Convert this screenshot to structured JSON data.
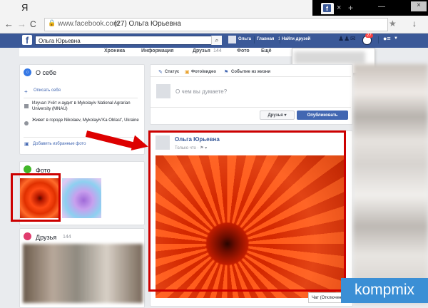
{
  "browser": {
    "tab_ya": "Я",
    "tab_fb_letter": "f",
    "tab_close": "×",
    "tab_new": "+",
    "window_min": "—",
    "window_close": "×",
    "url_domain": "www.facebook.com",
    "url_title": "(27) Ольга Юрьевна",
    "back": "←",
    "forward": "→",
    "reload": "C",
    "lock": "🔒",
    "bookmark": "★",
    "download": "↓"
  },
  "fb_bar": {
    "logo": "f",
    "search_value": "Ольга Юрьевна",
    "search_btn": "⌕",
    "user_name": "Ольга",
    "home": "Главная",
    "home_badge": "1",
    "find_friends": "Найти друзей",
    "notif_count": "27",
    "caret": "▼"
  },
  "profile_nav": [
    "Хроника",
    "Информация",
    "Друзья",
    "144",
    "Фото",
    "Ещё"
  ],
  "about": {
    "title": "О себе",
    "describe": "Описать себя",
    "study": "Изучал Учёт и аудит в Mykolayiv National Agrarian University (MNAU)",
    "live": "Живет в городе Nikolaev, Mykolayiv'Ka Oblast', Ukraine",
    "favorites": "Добавить избранные фото"
  },
  "photos": {
    "title": "Фото"
  },
  "friends": {
    "title": "Друзья",
    "count": "144"
  },
  "composer": {
    "status": "Статус",
    "photo_video": "Фото/видео",
    "life_event": "Событие из жизни",
    "placeholder": "О чем вы думаете?",
    "audience": "Друзья ▾",
    "publish": "Опубликовать"
  },
  "post": {
    "author": "Ольга Юрьевна",
    "time": "Только что · ⚑ ▾"
  },
  "chat": {
    "label": "Чат (Отключен"
  },
  "watermark": "kompmix"
}
